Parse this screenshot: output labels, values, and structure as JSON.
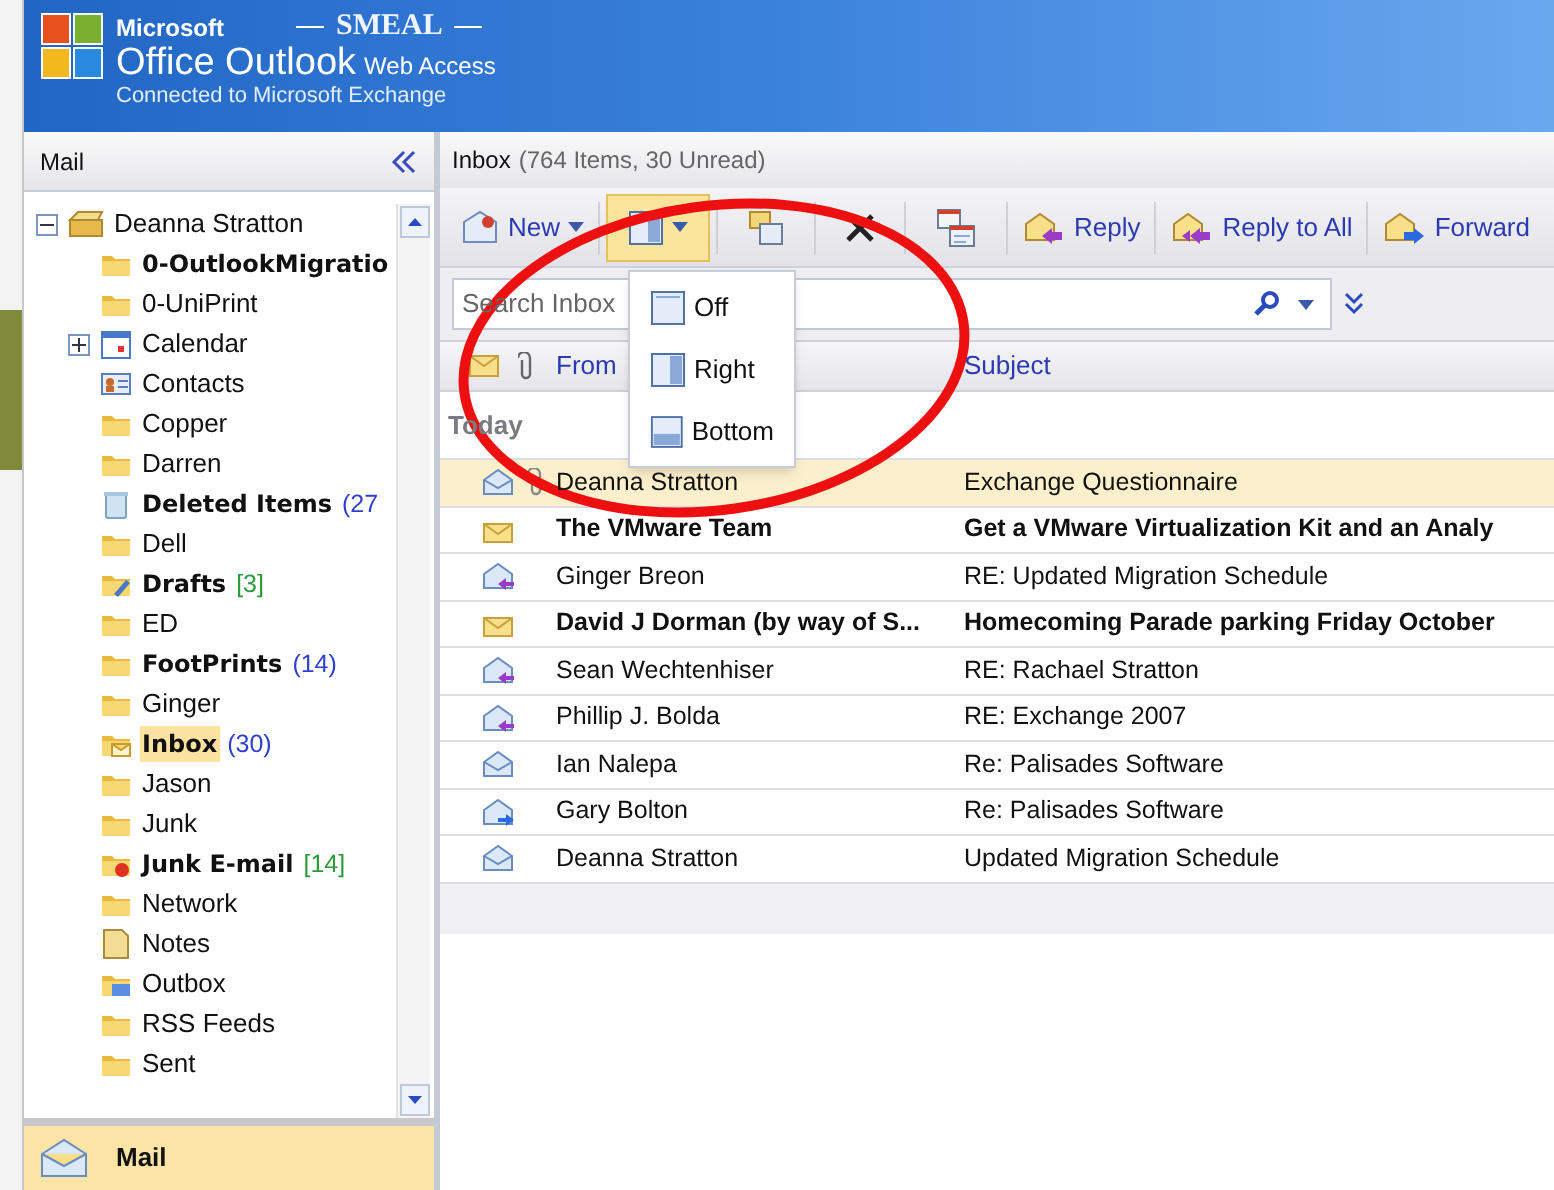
{
  "banner": {
    "company": "Microsoft",
    "org": "SMEAL",
    "product": "Office Outlook",
    "product_suffix": "Web Access",
    "subtitle": "Connected to Microsoft Exchange"
  },
  "nav": {
    "title": "Mail",
    "bottom_button": "Mail"
  },
  "folders": {
    "name": "Deanna Stratton",
    "kind": "mailbox",
    "expanded": true,
    "children": [
      {
        "name": "0-OutlookMigratio",
        "kind": "folder",
        "unread": true,
        "selected": false
      },
      {
        "name": "0-UniPrint",
        "kind": "folder",
        "unread": false,
        "selected": false
      },
      {
        "name": "Calendar",
        "kind": "calendar",
        "unread": false,
        "selected": false,
        "expanded": false
      },
      {
        "name": "Contacts",
        "kind": "contacts",
        "unread": false,
        "selected": false
      },
      {
        "name": "Copper",
        "kind": "folder",
        "unread": false,
        "selected": false
      },
      {
        "name": "Darren",
        "kind": "folder",
        "unread": false,
        "selected": false
      },
      {
        "name": "Deleted Items",
        "kind": "deleted",
        "unread": true,
        "selected": false,
        "count": {
          "text": "(27",
          "color": "#2f3fd0"
        }
      },
      {
        "name": "Dell",
        "kind": "folder",
        "unread": false,
        "selected": false
      },
      {
        "name": "Drafts",
        "kind": "drafts",
        "unread": true,
        "selected": false,
        "count": {
          "text": "[3]",
          "color": "#2a9a3a"
        }
      },
      {
        "name": "ED",
        "kind": "folder",
        "unread": false,
        "selected": false
      },
      {
        "name": "FootPrints",
        "kind": "folder",
        "unread": true,
        "selected": false,
        "count": {
          "text": "(14)",
          "color": "#2f3fd0"
        }
      },
      {
        "name": "Ginger",
        "kind": "folder",
        "unread": false,
        "selected": false
      },
      {
        "name": "Inbox",
        "kind": "inbox",
        "unread": true,
        "selected": true,
        "count": {
          "text": "(30)",
          "color": "#2f3fd0"
        }
      },
      {
        "name": "Jason",
        "kind": "folder",
        "unread": false,
        "selected": false
      },
      {
        "name": "Junk",
        "kind": "folder",
        "unread": false,
        "selected": false
      },
      {
        "name": "Junk E-mail",
        "kind": "junk",
        "unread": true,
        "selected": false,
        "count": {
          "text": "[14]",
          "color": "#2a9a3a"
        }
      },
      {
        "name": "Network",
        "kind": "folder",
        "unread": false,
        "selected": false
      },
      {
        "name": "Notes",
        "kind": "notes",
        "unread": false,
        "selected": false
      },
      {
        "name": "Outbox",
        "kind": "outbox",
        "unread": false,
        "selected": false
      },
      {
        "name": "RSS Feeds",
        "kind": "folder",
        "unread": false,
        "selected": false
      },
      {
        "name": "Sent",
        "kind": "folder",
        "unread": false,
        "selected": false
      }
    ]
  },
  "inbox": {
    "title": "Inbox",
    "summary": "(764 Items, 30 Unread)"
  },
  "toolbar": [
    {
      "kind": "new",
      "label": "New",
      "open": false
    },
    {
      "kind": "reading_pane",
      "open": true
    },
    {
      "kind": "move",
      "open": false
    },
    {
      "kind": "delete",
      "open": false
    },
    {
      "kind": "check",
      "open": false
    },
    {
      "kind": "reply",
      "label": "Reply",
      "open": false
    },
    {
      "kind": "reply_all",
      "label": "Reply to All",
      "open": false
    },
    {
      "kind": "forward",
      "label": "Forward",
      "open": false
    }
  ],
  "search": {
    "placeholder": "Search Inbox"
  },
  "columns": {
    "from": "From",
    "subject": "Subject"
  },
  "group_label": "Today",
  "menu": [
    {
      "label": "Off",
      "kind": "off"
    },
    {
      "label": "Right",
      "kind": "right"
    },
    {
      "label": "Bottom",
      "kind": "bottom"
    }
  ],
  "messages": [
    {
      "kind": "read",
      "attachment": true,
      "from": "Deanna Stratton",
      "subject": "Exchange Questionnaire",
      "unread": false,
      "selected": true
    },
    {
      "kind": "unread",
      "attachment": false,
      "from": "The VMware Team",
      "subject": "Get a VMware Virtualization Kit and an Analy",
      "unread": true,
      "selected": false
    },
    {
      "kind": "replied",
      "attachment": false,
      "from": "Ginger Breon",
      "subject": "RE: Updated Migration Schedule",
      "unread": false,
      "selected": false
    },
    {
      "kind": "unread",
      "attachment": false,
      "from": "David J Dorman (by way of S...",
      "subject": "Homecoming Parade parking Friday October",
      "unread": true,
      "selected": false
    },
    {
      "kind": "replied",
      "attachment": false,
      "from": "Sean Wechtenhiser",
      "subject": "RE: Rachael Stratton",
      "unread": false,
      "selected": false
    },
    {
      "kind": "replied",
      "attachment": false,
      "from": "Phillip J. Bolda",
      "subject": "RE: Exchange 2007",
      "unread": false,
      "selected": false
    },
    {
      "kind": "read",
      "attachment": false,
      "from": "Ian Nalepa",
      "subject": "Re: Palisades Software",
      "unread": false,
      "selected": false
    },
    {
      "kind": "forwarded",
      "attachment": false,
      "from": "Gary Bolton",
      "subject": "Re: Palisades Software",
      "unread": false,
      "selected": false
    },
    {
      "kind": "read",
      "attachment": false,
      "from": "Deanna Stratton",
      "subject": "Updated Migration Schedule",
      "unread": false,
      "selected": false
    }
  ]
}
